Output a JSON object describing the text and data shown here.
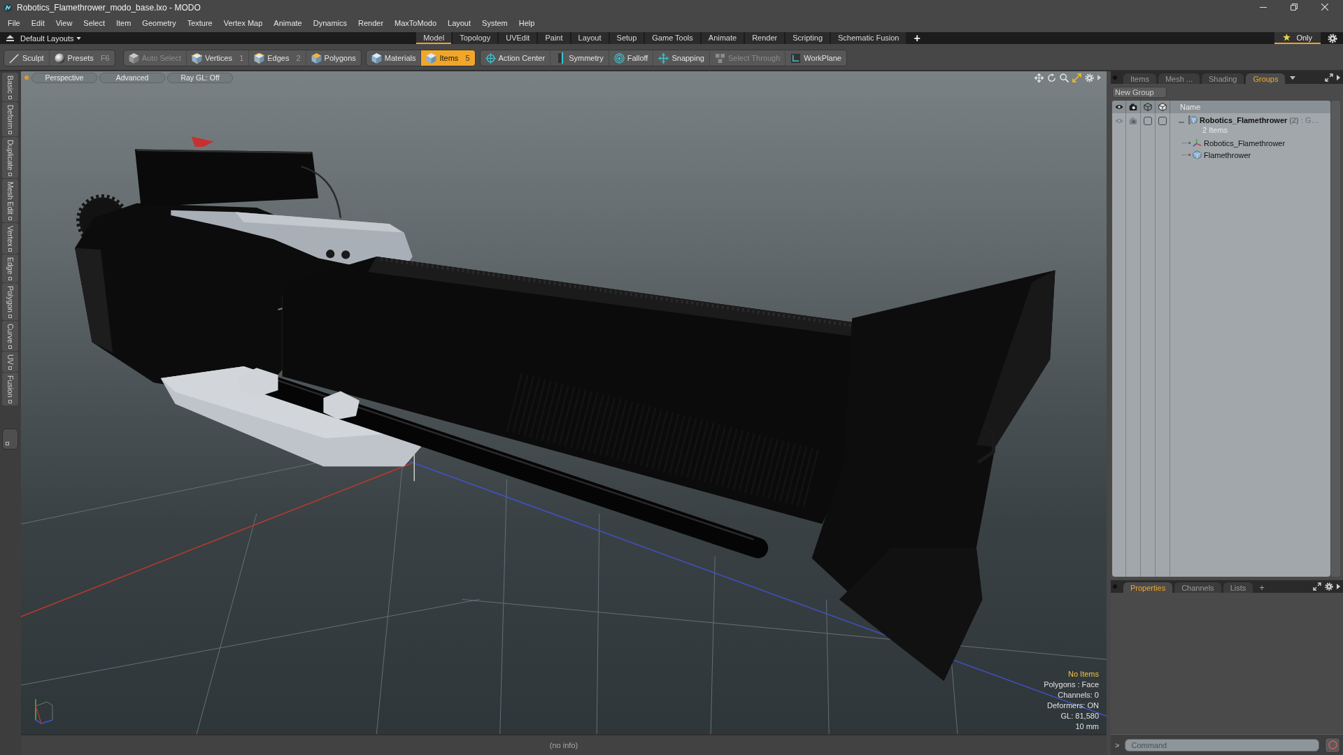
{
  "window": {
    "title": "Robotics_Flamethrower_modo_base.lxo - MODO"
  },
  "menu_bar": [
    "File",
    "Edit",
    "View",
    "Select",
    "Item",
    "Geometry",
    "Texture",
    "Vertex Map",
    "Animate",
    "Dynamics",
    "Render",
    "MaxToModo",
    "Layout",
    "System",
    "Help"
  ],
  "layout_bar": {
    "layout_menu": "Default Layouts",
    "tabs": [
      {
        "label": "Model",
        "selected": true
      },
      {
        "label": "Topology",
        "selected": false
      },
      {
        "label": "UVEdit",
        "selected": false
      },
      {
        "label": "Paint",
        "selected": false
      },
      {
        "label": "Layout",
        "selected": false
      },
      {
        "label": "Setup",
        "selected": false
      },
      {
        "label": "Game Tools",
        "selected": false
      },
      {
        "label": "Animate",
        "selected": false
      },
      {
        "label": "Render",
        "selected": false
      },
      {
        "label": "Scripting",
        "selected": false
      },
      {
        "label": "Schematic Fusion",
        "selected": false
      }
    ],
    "add_tab": "+",
    "favorites": {
      "label": "Only",
      "selected": true
    }
  },
  "toolbar": {
    "groups": [
      {
        "items": [
          {
            "kind": "sculpt",
            "label": "Sculpt",
            "selected": false,
            "disabled": false
          },
          {
            "kind": "presets",
            "label": "Presets",
            "shortcut": "F6",
            "selected": false,
            "disabled": false
          }
        ]
      },
      {
        "items": [
          {
            "kind": "auto_select",
            "label": "Auto Select",
            "selected": false,
            "disabled": true
          },
          {
            "kind": "vertices",
            "label": "Vertices",
            "shortcut": "1",
            "selected": false,
            "disabled": false
          },
          {
            "kind": "edges",
            "label": "Edges",
            "shortcut": "2",
            "selected": false,
            "disabled": false
          },
          {
            "kind": "polygons",
            "label": "Polygons",
            "selected": false,
            "disabled": false
          }
        ]
      },
      {
        "items": [
          {
            "kind": "materials",
            "label": "Materials",
            "selected": false,
            "disabled": false
          },
          {
            "kind": "items",
            "label": "Items",
            "shortcut": "5",
            "selected": true,
            "disabled": false
          }
        ]
      },
      {
        "items": [
          {
            "kind": "action_center",
            "label": "Action Center",
            "selected": false,
            "disabled": false
          },
          {
            "kind": "symmetry",
            "label": "Symmetry",
            "selected": false,
            "disabled": false
          },
          {
            "kind": "falloff",
            "label": "Falloff",
            "selected": false,
            "disabled": false
          },
          {
            "kind": "snapping",
            "label": "Snapping",
            "selected": false,
            "disabled": false
          },
          {
            "kind": "select_through",
            "label": "Select Through",
            "selected": false,
            "disabled": true
          },
          {
            "kind": "workplane",
            "label": "WorkPlane",
            "selected": false,
            "disabled": false
          }
        ]
      }
    ]
  },
  "side_tabs": [
    "Basic",
    "Deform",
    "Duplicate",
    "Mesh Edit",
    "Vertex",
    "Edge",
    "Polygon",
    "Curve",
    "UV",
    "Fusion"
  ],
  "viewport": {
    "buttons": [
      "Perspective",
      "Advanced",
      "Ray GL: Off"
    ],
    "info": [
      {
        "text": "No Items",
        "highlighted": true
      },
      {
        "text": "Polygons : Face",
        "highlighted": false
      },
      {
        "text": "Channels: 0",
        "highlighted": false
      },
      {
        "text": "Deformers: ON",
        "highlighted": false
      },
      {
        "text": "GL: 81,580",
        "highlighted": false
      },
      {
        "text": "10 mm",
        "highlighted": false
      }
    ]
  },
  "status_bar": {
    "text": "(no info)"
  },
  "groups_panel": {
    "tabs": [
      {
        "label": "Items",
        "selected": false
      },
      {
        "label": "Mesh ...",
        "selected": false
      },
      {
        "label": "Shading",
        "selected": false
      },
      {
        "label": "Groups",
        "selected": true
      }
    ],
    "new_group": "New Group",
    "name_column": "Name",
    "tree": [
      {
        "kind": "group",
        "name": "Robotics_Flamethrower",
        "count": "(2)",
        "type": ": G…",
        "subtitle": "2 Items",
        "expanded": true,
        "visible": true,
        "render": true,
        "lock": false,
        "select": false,
        "children": [
          {
            "kind": "locator",
            "name": "Robotics_Flamethrower"
          },
          {
            "kind": "mesh",
            "name": "Flamethrower"
          }
        ]
      }
    ]
  },
  "properties_panel": {
    "tabs": [
      {
        "label": "Properties",
        "selected": true
      },
      {
        "label": "Channels",
        "selected": false
      },
      {
        "label": "Lists",
        "selected": false
      }
    ],
    "add_tab": "+"
  },
  "command_bar": {
    "prompt": ">",
    "placeholder": "Command"
  }
}
